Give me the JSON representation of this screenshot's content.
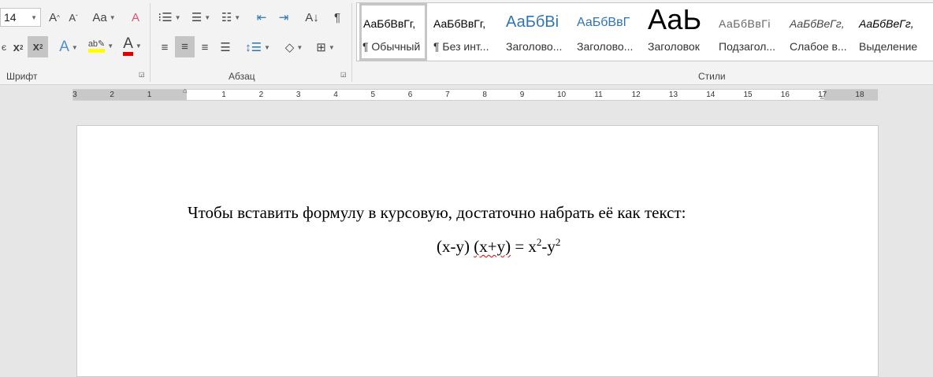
{
  "ribbon": {
    "font_group": {
      "label": "Шрифт",
      "font_size": "14"
    },
    "paragraph_group": {
      "label": "Абзац"
    },
    "styles_group": {
      "label": "Стили",
      "items": [
        {
          "preview": "АаБбВвГг,",
          "name": "¶ Обычный",
          "selected": true
        },
        {
          "preview": "АаБбВвГг,",
          "name": "¶ Без инт..."
        },
        {
          "preview": "АаБбВі",
          "name": "Заголово..."
        },
        {
          "preview": "АаБбВвГ",
          "name": "Заголово..."
        },
        {
          "preview": "АаЬ",
          "name": "Заголовок"
        },
        {
          "preview": "АаБбВвГі",
          "name": "Подзагол..."
        },
        {
          "preview": "АаБбВеГг,",
          "name": "Слабое в..."
        },
        {
          "preview": "АаБбВеГг,",
          "name": "Выделение"
        }
      ]
    },
    "colors": {
      "highlight": "#ffff00",
      "font_color": "#e00000",
      "heading": "#2e74b5"
    }
  },
  "ruler": {
    "left_numbers": [
      "3",
      "2",
      "1"
    ],
    "numbers": [
      "1",
      "2",
      "3",
      "4",
      "5",
      "6",
      "7",
      "8",
      "9",
      "10",
      "11",
      "12",
      "13",
      "14",
      "15",
      "16",
      "17",
      "18"
    ]
  },
  "document": {
    "line1": "Чтобы вставить формулу в курсовую, достаточно набрать её как текст:",
    "formula_part1": "(x-y) ",
    "formula_part2": "(x+y)",
    "formula_part3": " = x",
    "sup1": "2",
    "formula_part4": "-y",
    "sup2": "2"
  }
}
